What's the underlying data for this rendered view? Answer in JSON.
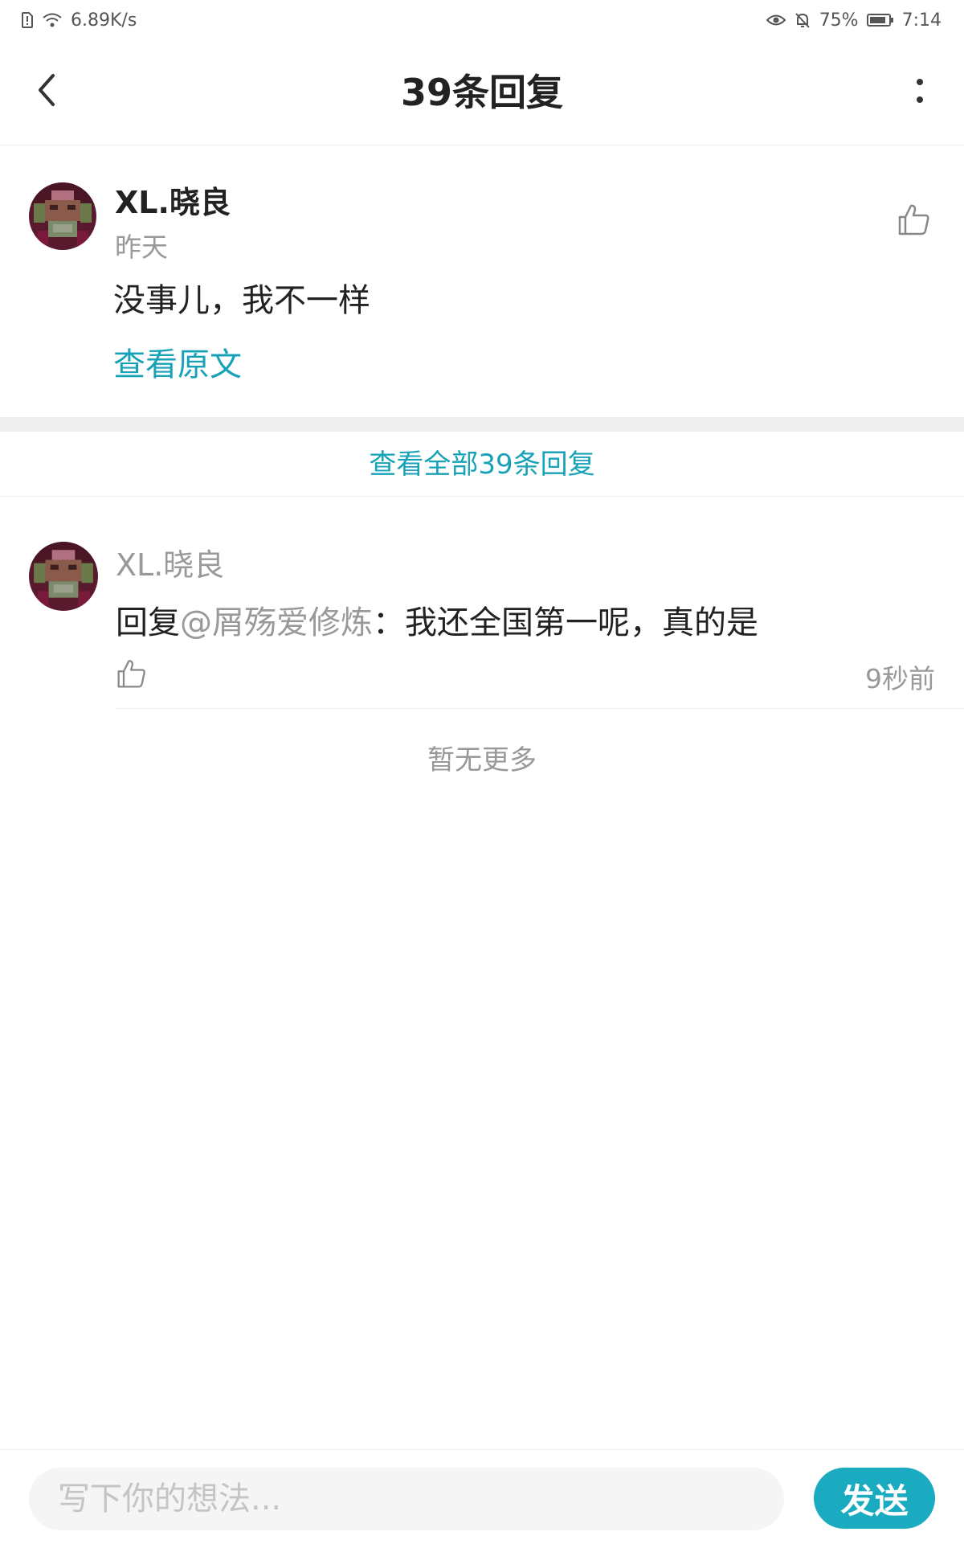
{
  "status_bar": {
    "net_speed": "6.89K/s",
    "battery": "75%",
    "time": "7:14",
    "icons": [
      "sim-alert-icon",
      "wifi-icon",
      "eye-icon",
      "bell-off-icon",
      "battery-icon"
    ]
  },
  "header": {
    "title": "39条回复",
    "back_icon": "chevron-left-icon",
    "more_icon": "more-vertical-icon"
  },
  "original_comment": {
    "author": "XL.晓良",
    "time": "昨天",
    "body": "没事儿，我不一样",
    "view_original": "查看原文",
    "like_icon": "thumbs-up-icon"
  },
  "view_all_replies": "查看全部39条回复",
  "replies": [
    {
      "author": "XL.晓良",
      "prefix": "回复",
      "mention": "@屑殇爱修炼",
      "text": "：我还全国第一呢，真的是",
      "time": "9秒前",
      "like_icon": "thumbs-up-icon"
    }
  ],
  "no_more": "暂无更多",
  "input": {
    "placeholder": "写下你的想法...",
    "send_label": "发送"
  },
  "colors": {
    "accent": "#17a2b8",
    "send_button": "#1aabc0",
    "muted_text": "#999999",
    "divider": "#eeeeee"
  }
}
